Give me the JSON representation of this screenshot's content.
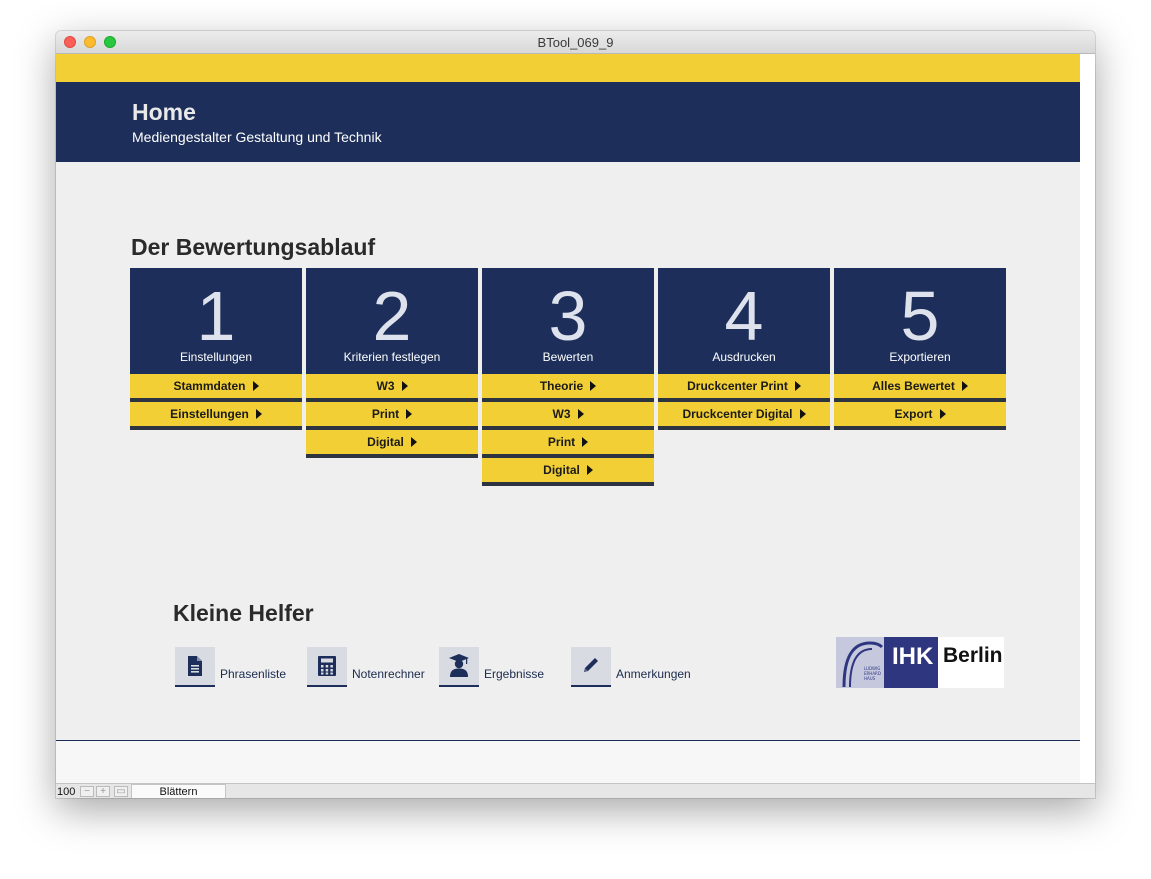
{
  "window": {
    "title": "BTool_069_9"
  },
  "header": {
    "title": "Home",
    "subtitle": "Mediengestalter Gestaltung und Technik"
  },
  "workflow": {
    "title": "Der Bewertungsablauf",
    "steps": [
      {
        "number": "1",
        "caption": "Einstellungen",
        "buttons": [
          "Stammdaten",
          "Einstellungen"
        ]
      },
      {
        "number": "2",
        "caption": "Kriterien festlegen",
        "buttons": [
          "W3",
          "Print",
          "Digital"
        ]
      },
      {
        "number": "3",
        "caption": "Bewerten",
        "buttons": [
          "Theorie",
          "W3",
          "Print",
          "Digital"
        ]
      },
      {
        "number": "4",
        "caption": "Ausdrucken",
        "buttons": [
          "Druckcenter Print",
          "Druckcenter Digital"
        ]
      },
      {
        "number": "5",
        "caption": "Exportieren",
        "buttons": [
          "Alles Bewertet",
          "Export"
        ]
      }
    ]
  },
  "helpers": {
    "title": "Kleine Helfer",
    "items": [
      {
        "label": "Phrasenliste",
        "icon": "document-icon"
      },
      {
        "label": "Notenrechner",
        "icon": "calculator-icon"
      },
      {
        "label": "Ergebnisse",
        "icon": "graduate-icon"
      },
      {
        "label": "Anmerkungen",
        "icon": "pencil-icon"
      }
    ]
  },
  "logo": {
    "brand": "IHK",
    "city": "Berlin",
    "arch_text": "LUDWIG ERHARD HAUS"
  },
  "statusbar": {
    "zoom": "100",
    "mode": "Blättern"
  },
  "colors": {
    "navy": "#1c2e59",
    "yellow": "#f2cf35",
    "background": "#efefef"
  }
}
